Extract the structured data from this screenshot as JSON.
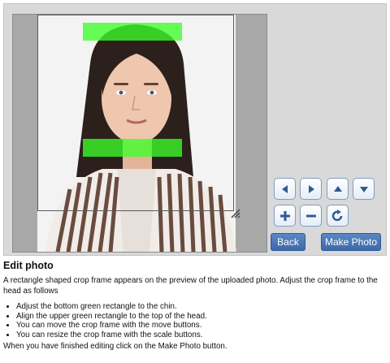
{
  "heading": "Edit photo",
  "intro": "A rectangle shaped crop frame appears on the preview of the uploaded photo. Adjust the crop frame to the head as follows",
  "steps": [
    "Adjust the bottom green rectangle to the chin.",
    "Align the upper green rectangle to the top of the head.",
    "You can move the crop frame with the move buttons.",
    "You can resize the crop frame with the scale buttons."
  ],
  "finish": "When you have finished editing click on the Make Photo button.",
  "buttons": {
    "back": "Back",
    "make_photo": "Make Photo"
  },
  "controls": {
    "icons": [
      "arrow-left-icon",
      "arrow-right-icon",
      "arrow-up-icon",
      "arrow-down-icon",
      "plus-icon",
      "minus-icon",
      "rotate-icon"
    ]
  },
  "colors": {
    "guide_green": "#3cff28",
    "button_blue": "#3d6aa8",
    "panel_bg": "#d9d9d9"
  }
}
